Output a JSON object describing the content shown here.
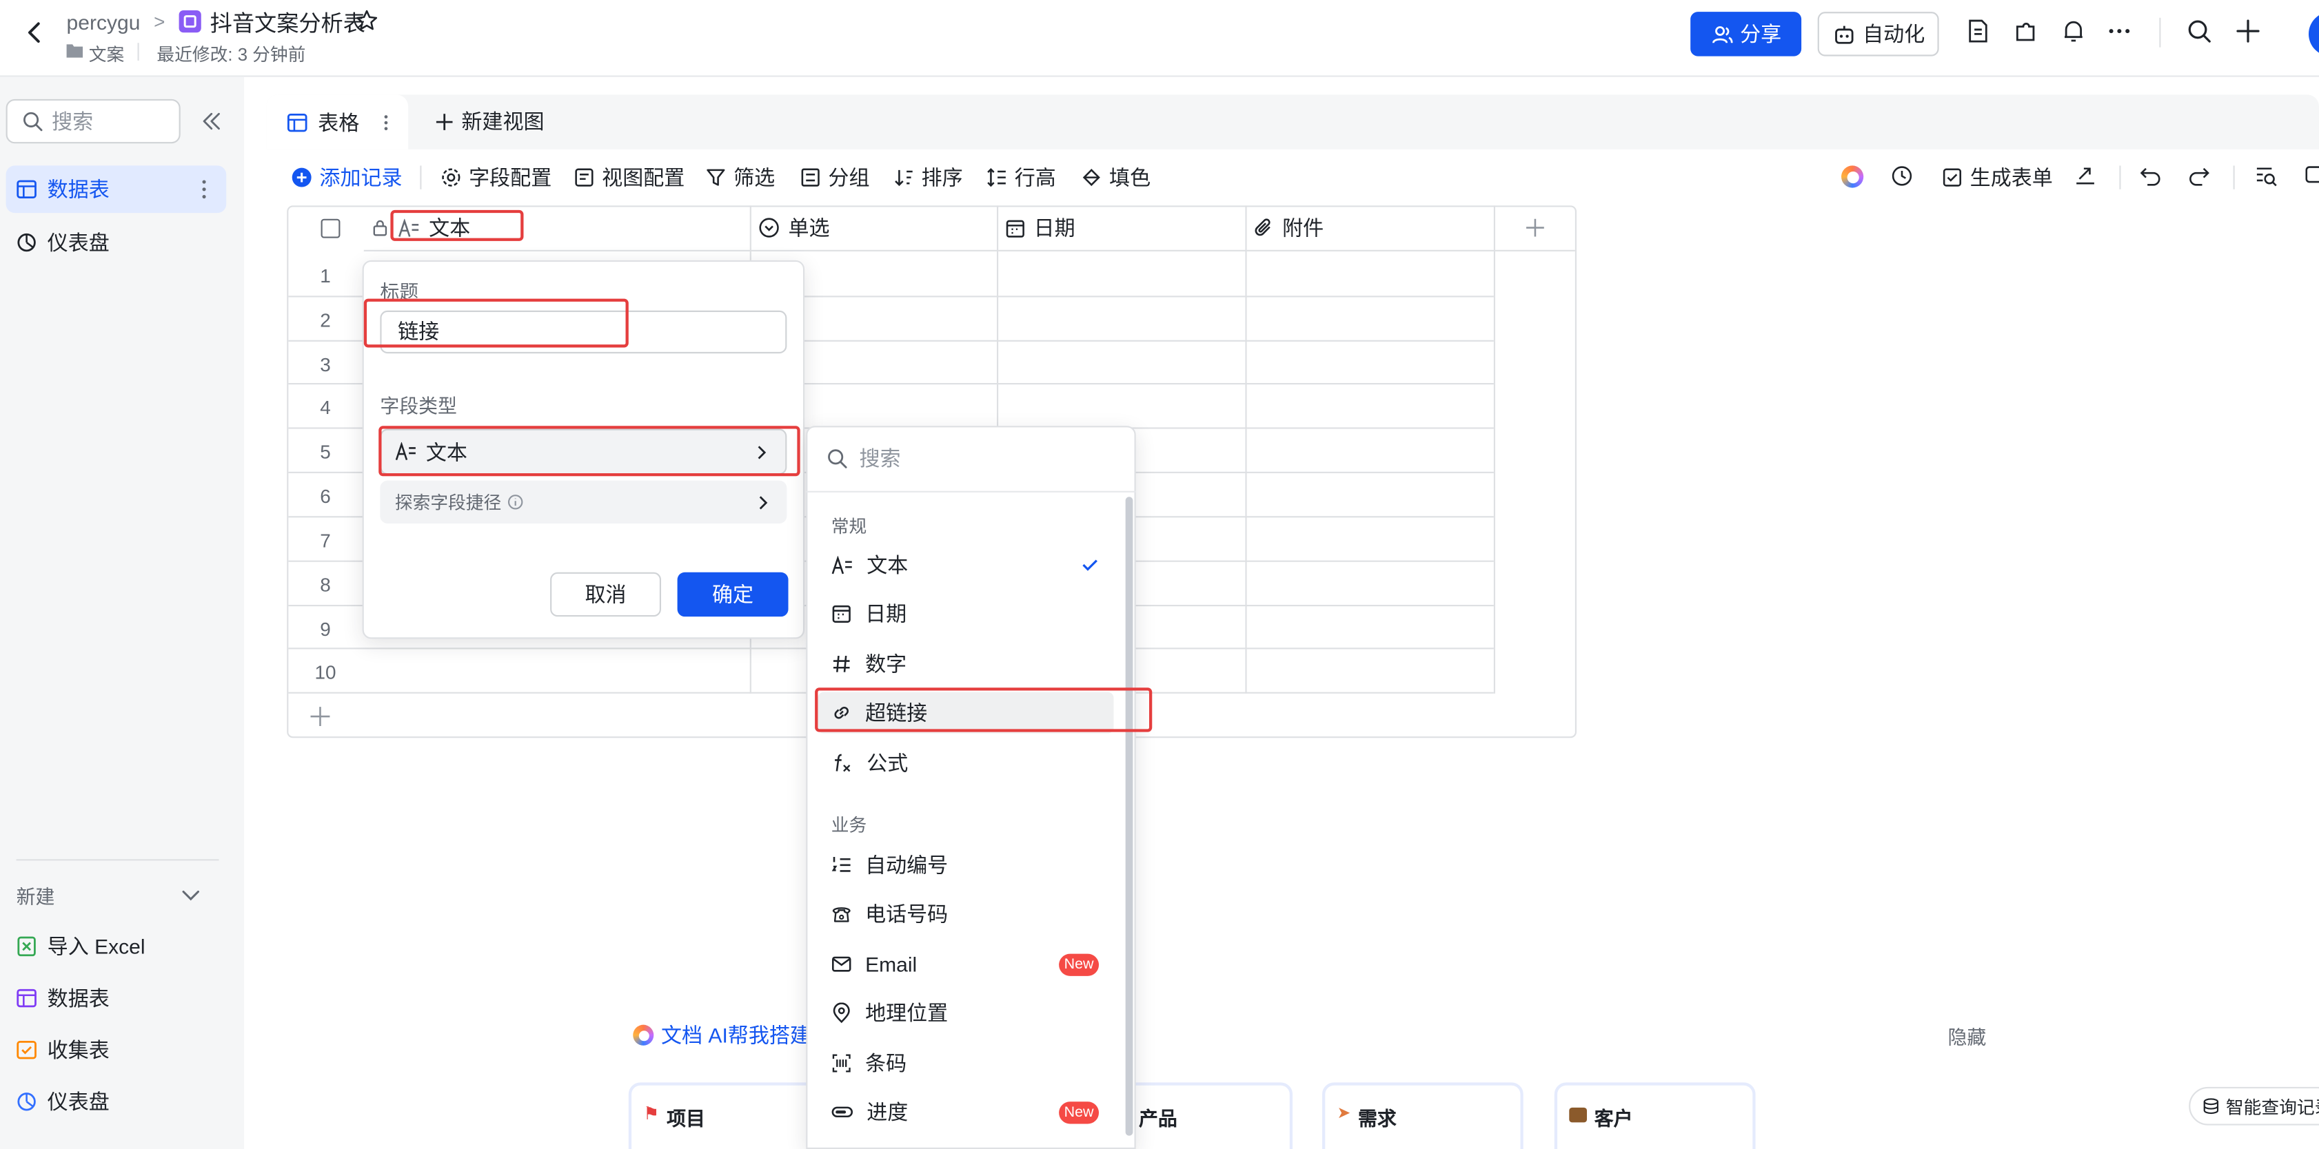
{
  "header": {
    "owner": "percygu",
    "separator": ">",
    "title": "抖音文案分析表",
    "folder": "文案",
    "modified": "最近修改: 3 分钟前",
    "share_label": "分享",
    "automation_label": "自动化"
  },
  "sidebar": {
    "search_placeholder": "搜索",
    "items": [
      {
        "label": "数据表",
        "active": true
      },
      {
        "label": "仪表盘",
        "active": false
      }
    ],
    "new_label": "新建",
    "new_items": [
      {
        "label": "导入 Excel",
        "icon": "excel-icon",
        "color": "#34a853"
      },
      {
        "label": "数据表",
        "icon": "table-icon",
        "color": "#7f3bf5"
      },
      {
        "label": "收集表",
        "icon": "form-icon",
        "color": "#ff8800"
      },
      {
        "label": "仪表盘",
        "icon": "dashboard-icon",
        "color": "#3370ff"
      }
    ]
  },
  "tabs": {
    "active_label": "表格",
    "new_view_label": "新建视图"
  },
  "toolbar": {
    "add_record": "添加记录",
    "field_config": "字段配置",
    "view_config": "视图配置",
    "filter": "筛选",
    "group": "分组",
    "sort": "排序",
    "row_height": "行高",
    "fill": "填色",
    "generate_form": "生成表单"
  },
  "grid": {
    "columns": [
      {
        "label": "文本",
        "icon": "text-type-icon"
      },
      {
        "label": "单选",
        "icon": "single-select-icon"
      },
      {
        "label": "日期",
        "icon": "calendar-icon"
      },
      {
        "label": "附件",
        "icon": "attachment-icon"
      }
    ],
    "row_numbers": [
      "1",
      "2",
      "3",
      "4",
      "5",
      "6",
      "7",
      "8",
      "9",
      "10"
    ]
  },
  "field_editor": {
    "title_label": "标题",
    "title_value": "链接",
    "type_label": "字段类型",
    "type_value": "文本",
    "explore_label": "探索字段捷径",
    "cancel_label": "取消",
    "confirm_label": "确定"
  },
  "type_menu": {
    "search_placeholder": "搜索",
    "group_general": "常规",
    "group_business": "业务",
    "general_items": [
      {
        "label": "文本",
        "icon": "text-type-icon",
        "checked": true
      },
      {
        "label": "日期",
        "icon": "calendar-icon"
      },
      {
        "label": "数字",
        "icon": "hash-icon"
      },
      {
        "label": "超链接",
        "icon": "link-icon",
        "hover": true
      },
      {
        "label": "公式",
        "icon": "formula-icon"
      }
    ],
    "business_items": [
      {
        "label": "自动编号",
        "icon": "auto-number-icon"
      },
      {
        "label": "电话号码",
        "icon": "phone-icon"
      },
      {
        "label": "Email",
        "icon": "email-icon",
        "badge": "New"
      },
      {
        "label": "地理位置",
        "icon": "location-icon"
      },
      {
        "label": "条码",
        "icon": "barcode-icon"
      },
      {
        "label": "进度",
        "icon": "progress-icon",
        "badge": "New"
      }
    ]
  },
  "bottom": {
    "ai_build": "文档 AI帮我搭建",
    "hide": "隐藏",
    "cards": [
      "项目",
      "产品",
      "需求",
      "客户"
    ],
    "smart_query": "智能查询记录"
  },
  "colors": {
    "primary": "#1456f0",
    "highlight": "#e53e3e",
    "badge": "#f54a45"
  }
}
